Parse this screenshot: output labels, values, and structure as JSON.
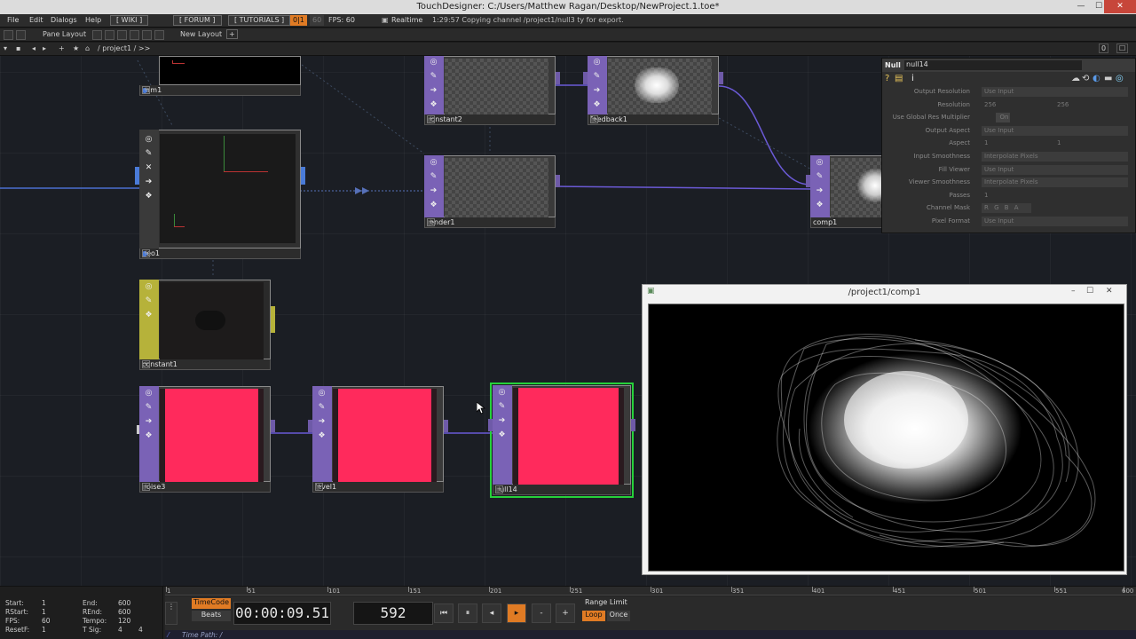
{
  "window": {
    "title": "TouchDesigner: C:/Users/Matthew Ragan/Desktop/NewProject.1.toe*",
    "minimize": "—",
    "maximize": "☐",
    "close": "✕"
  },
  "menu": {
    "file": "File",
    "edit": "Edit",
    "dialogs": "Dialogs",
    "help": "Help",
    "wiki": "[ WIKI ]",
    "forum": "[ FORUM ]",
    "tutorials": "[ TUTORIALS ]",
    "fps_toggle": "0|1",
    "fps_input": "60",
    "fps_label": "FPS: 60",
    "realtime": "Realtime",
    "status": "1:29:57 Copying channel /project1/null3 ty for export."
  },
  "panebar": {
    "pane_layout": "Pane Layout",
    "new_layout": "New Layout",
    "add": "+"
  },
  "pathbar": {
    "path": "/ project1 / >>",
    "right_num": "0"
  },
  "nodes": [
    {
      "id": "cam1",
      "label": "cam1"
    },
    {
      "id": "geo1",
      "label": "geo1"
    },
    {
      "id": "constant1",
      "label": "constant1"
    },
    {
      "id": "constant2",
      "label": "constant2"
    },
    {
      "id": "render1",
      "label": "render1"
    },
    {
      "id": "feedback1",
      "label": "feedback1"
    },
    {
      "id": "comp1",
      "label": "comp1"
    },
    {
      "id": "noise3",
      "label": "noise3"
    },
    {
      "id": "level1",
      "label": "level1"
    },
    {
      "id": "null14",
      "label": "null14"
    }
  ],
  "params": {
    "type": "Null",
    "name": "null14",
    "rows": [
      {
        "label": "Output Resolution",
        "value": "Use Input"
      },
      {
        "label": "Resolution",
        "value": "256",
        "value2": "256"
      },
      {
        "label": "Use Global Res Multiplier",
        "value": "On"
      },
      {
        "label": "Output Aspect",
        "value": "Use Input"
      },
      {
        "label": "Aspect",
        "value": "1",
        "value2": "1"
      },
      {
        "label": "Input Smoothness",
        "value": "Interpolate Pixels"
      },
      {
        "label": "Fill Viewer",
        "value": "Use Input"
      },
      {
        "label": "Viewer Smoothness",
        "value": "Interpolate Pixels"
      },
      {
        "label": "Passes",
        "value": "1"
      },
      {
        "label": "Channel Mask",
        "value": "R G B A"
      },
      {
        "label": "Pixel Format",
        "value": "Use Input"
      }
    ]
  },
  "viewer": {
    "title": "/project1/comp1",
    "minimize": "–",
    "maximize": "☐",
    "close": "✕"
  },
  "stats": {
    "start_label": "Start:",
    "start": "1",
    "rstart_label": "RStart:",
    "rstart": "1",
    "fps_label": "FPS:",
    "fps": "60",
    "resetf_label": "ResetF:",
    "resetf": "1",
    "end_label": "End:",
    "end": "600",
    "rend_label": "REnd:",
    "rend": "600",
    "tempo_label": "Tempo:",
    "tempo": "120",
    "tsig_label": "T Sig:",
    "tsig_a": "4",
    "tsig_b": "4"
  },
  "ruler": {
    "ticks": [
      "1",
      "51",
      "101",
      "151",
      "201",
      "251",
      "301",
      "351",
      "401",
      "451",
      "501",
      "551",
      "600"
    ]
  },
  "transport": {
    "timecode_btn": "TimeCode",
    "beats_btn": "Beats",
    "timecode": "00:00:09.51",
    "frame": "592",
    "rewind": "⏮",
    "pause": "⏸",
    "step_back": "◂",
    "play": "▸",
    "minus": "-",
    "plus": "+",
    "range_limit": "Range Limit",
    "loop": "Loop",
    "once": "Once"
  },
  "timepath": {
    "label": "Time Path: /"
  },
  "colors": {
    "accent_orange": "#e07b24",
    "selection_green": "#26d13a",
    "top_purple": "#6e5aa8",
    "noise_pink": "#ff2a5c"
  }
}
